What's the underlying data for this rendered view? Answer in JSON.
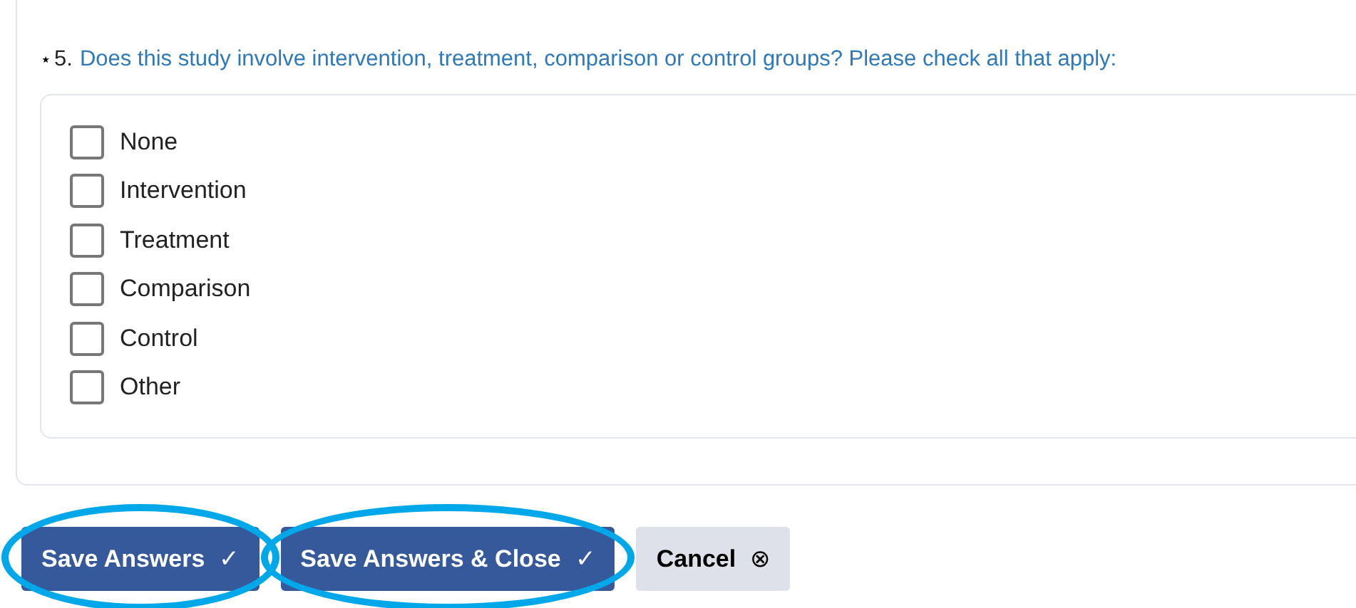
{
  "question": {
    "marker": "⋆",
    "number": "5.",
    "text": "Does this study involve intervention, treatment, comparison or control groups? Please check all that apply:"
  },
  "options": [
    {
      "label": "None",
      "checked": false
    },
    {
      "label": "Intervention",
      "checked": false
    },
    {
      "label": "Treatment",
      "checked": false
    },
    {
      "label": "Comparison",
      "checked": false
    },
    {
      "label": "Control",
      "checked": false
    },
    {
      "label": "Other",
      "checked": false
    }
  ],
  "buttons": [
    {
      "kind": "primary",
      "label": "Save Answers",
      "icon": "✓",
      "highlighted": true
    },
    {
      "kind": "primary",
      "label": "Save Answers & Close",
      "icon": "✓",
      "highlighted": true
    },
    {
      "kind": "secondary",
      "label": "Cancel",
      "icon": "⊗",
      "highlighted": false
    }
  ]
}
